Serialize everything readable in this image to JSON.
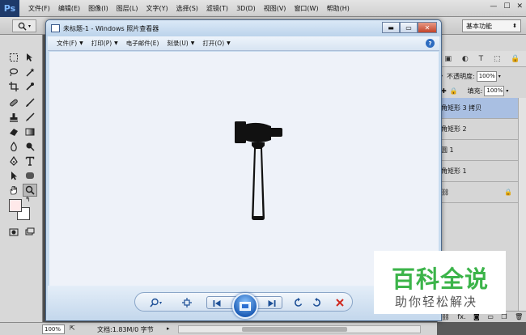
{
  "photoshop": {
    "logo": "Ps",
    "menu": [
      "文件(F)",
      "编辑(E)",
      "图像(I)",
      "图层(L)",
      "文字(Y)",
      "选择(S)",
      "滤镜(T)",
      "3D(D)",
      "视图(V)",
      "窗口(W)",
      "帮助(H)"
    ],
    "window_controls": [
      "—",
      "☐",
      "✕"
    ],
    "workspace": "基本功能",
    "layers_panel": {
      "opacity_label": "不透明度:",
      "opacity_value": "100%",
      "fill_label": "填充:",
      "fill_value": "100%",
      "layers": [
        "角矩形 3 拷贝",
        "角矩形 2",
        "圆 1",
        "角矩形 1"
      ],
      "selected_layer": "角矩形 3 拷贝"
    },
    "status": {
      "zoom": "100%",
      "doc_info": "文档:1.83M/0 字节"
    },
    "colors": {
      "foreground": "#ffe9ea",
      "background": "#ffffff"
    }
  },
  "viewer": {
    "title": "未标题-1 - Windows 照片查看器",
    "menu": [
      "文件(F)",
      "打印(P)",
      "电子邮件(E)",
      "刻录(U)",
      "打开(O)"
    ],
    "help": "?",
    "image_subject": "hammer-icon",
    "background": "#eef2f9"
  },
  "watermark": {
    "main": "百科全说",
    "sub": "助你轻松解决",
    "color": "#3cb44a"
  }
}
